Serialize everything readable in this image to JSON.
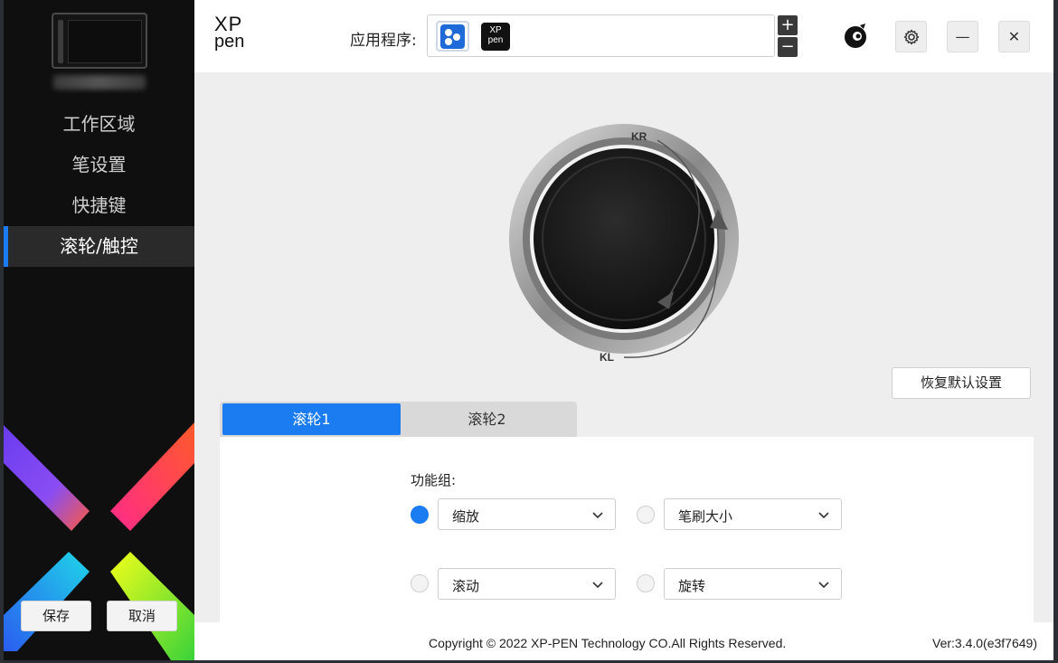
{
  "sidebar": {
    "items": [
      {
        "label": "工作区域"
      },
      {
        "label": "笔设置"
      },
      {
        "label": "快捷键"
      },
      {
        "label": "滚轮/触控"
      }
    ],
    "save_label": "保存",
    "cancel_label": "取消"
  },
  "header": {
    "logo_line1": "XP",
    "logo_line2": "pen",
    "app_label": "应用程序:",
    "app_icon2_text_line1": "XP",
    "app_icon2_text_line2": "pen",
    "add_label": "+",
    "remove_label": "−",
    "minimize_label": "—",
    "close_label": "✕"
  },
  "wheel": {
    "kr_label": "KR",
    "kl_label": "KL",
    "restore_label": "恢复默认设置"
  },
  "tabs": [
    {
      "label": "滚轮1"
    },
    {
      "label": "滚轮2"
    }
  ],
  "function_group": {
    "label": "功能组:",
    "options": [
      {
        "value": "缩放",
        "checked": true
      },
      {
        "value": "笔刷大小",
        "checked": false
      },
      {
        "value": "滚动",
        "checked": false
      },
      {
        "value": "旋转",
        "checked": false
      }
    ]
  },
  "footer": {
    "copyright": "Copyright © 2022  XP-PEN Technology CO.All Rights Reserved.",
    "version": "Ver:3.4.0(e3f7649)"
  },
  "colors": {
    "accent": "#1a7cf0",
    "sidebar_bg": "#0f0f0f"
  }
}
